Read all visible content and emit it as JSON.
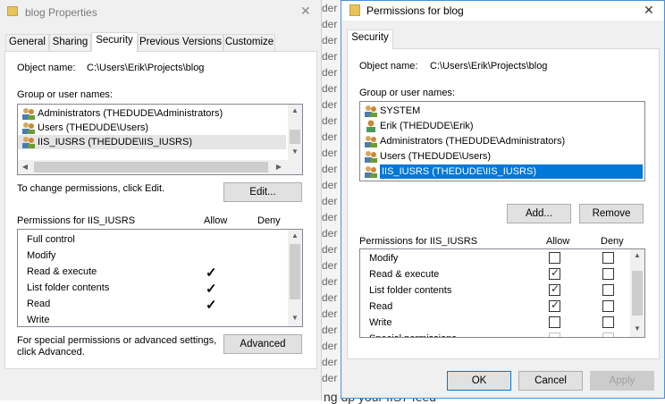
{
  "background": {
    "lines": [
      "der",
      "der",
      "der",
      "der",
      "der",
      "der",
      "der",
      "der",
      "der",
      "der",
      "der",
      "der",
      "der",
      "der",
      "der",
      "der",
      "der",
      "der",
      "der",
      "der",
      "der",
      "der",
      "der",
      "der"
    ],
    "bottom_text": "ng up your IIS7 feed"
  },
  "left_dialog": {
    "title": "blog Properties",
    "close_glyph": "✕",
    "tabs": [
      "General",
      "Sharing",
      "Security",
      "Previous Versions",
      "Customize"
    ],
    "object_name_label": "Object name:",
    "object_name_value": "C:\\Users\\Erik\\Projects\\blog",
    "group_label": "Group or user names:",
    "users": [
      "Administrators (THEDUDE\\Administrators)",
      "Users (THEDUDE\\Users)",
      "IIS_IUSRS (THEDUDE\\IIS_IUSRS)"
    ],
    "change_text": "To change permissions, click Edit.",
    "edit_button": "Edit...",
    "perm_header": "Permissions for IIS_IUSRS",
    "allow_header": "Allow",
    "deny_header": "Deny",
    "permissions": [
      {
        "name": "Full control",
        "allow": false
      },
      {
        "name": "Modify",
        "allow": false
      },
      {
        "name": "Read & execute",
        "allow": true
      },
      {
        "name": "List folder contents",
        "allow": true
      },
      {
        "name": "Read",
        "allow": true
      },
      {
        "name": "Write",
        "allow": false
      }
    ],
    "special_text_1": "For special permissions or advanced settings,",
    "special_text_2": "click Advanced.",
    "advanced_button": "Advanced"
  },
  "right_dialog": {
    "title": "Permissions for blog",
    "close_glyph": "✕",
    "tab": "Security",
    "object_name_label": "Object name:",
    "object_name_value": "C:\\Users\\Erik\\Projects\\blog",
    "group_label": "Group or user names:",
    "users": [
      "SYSTEM",
      "Erik (THEDUDE\\Erik)",
      "Administrators (THEDUDE\\Administrators)",
      "Users (THEDUDE\\Users)",
      "IIS_IUSRS (THEDUDE\\IIS_IUSRS)"
    ],
    "selected_user_index": 4,
    "add_button": "Add...",
    "remove_button": "Remove",
    "perm_header": "Permissions for IIS_IUSRS",
    "allow_header": "Allow",
    "deny_header": "Deny",
    "permissions": [
      {
        "name": "Modify",
        "allow": false,
        "deny": false
      },
      {
        "name": "Read & execute",
        "allow": true,
        "deny": false
      },
      {
        "name": "List folder contents",
        "allow": true,
        "deny": false
      },
      {
        "name": "Read",
        "allow": true,
        "deny": false
      },
      {
        "name": "Write",
        "allow": false,
        "deny": false
      },
      {
        "name": "Special permissions",
        "allow": false,
        "deny": false
      }
    ],
    "ok_button": "OK",
    "cancel_button": "Cancel",
    "apply_button": "Apply"
  },
  "colors": {
    "selection": "#0078d7",
    "focus_border": "#0078d7"
  }
}
